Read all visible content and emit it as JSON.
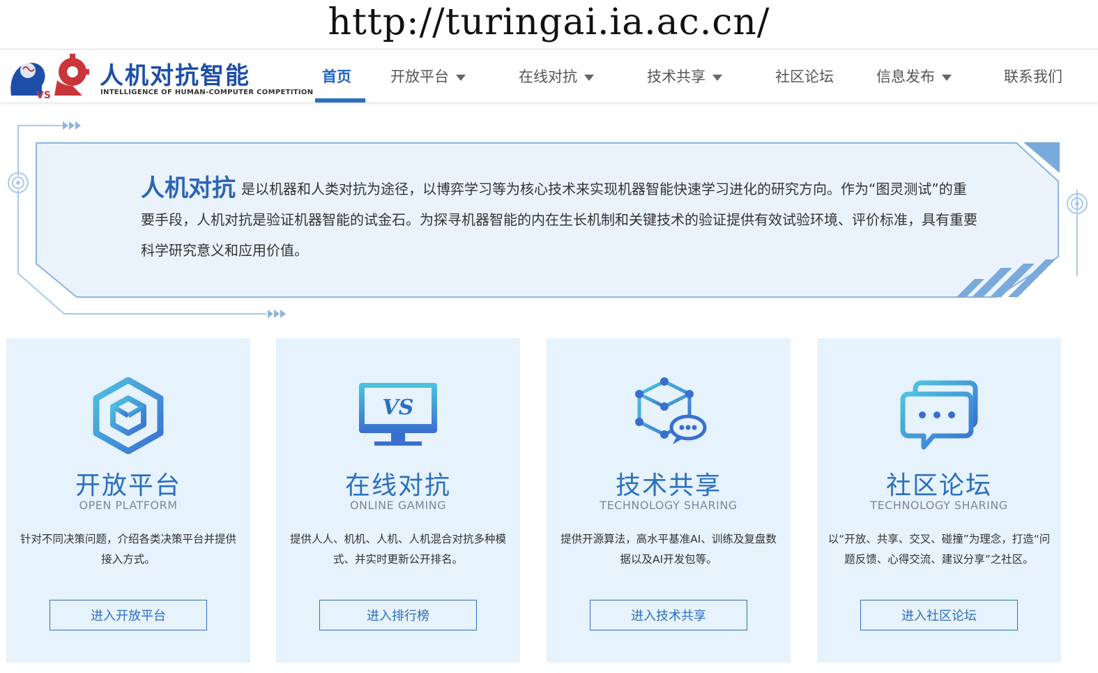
{
  "caption": {
    "url": "http://turingai.ia.ac.cn/"
  },
  "header": {
    "logo_title": "人机对抗智能",
    "logo_subtitle": "INTELLIGENCE OF HUMAN-COMPUTER COMPETITION",
    "logo_vs": "VS",
    "nav": [
      {
        "label": "首页",
        "active": true,
        "dropdown": false
      },
      {
        "label": "开放平台",
        "active": false,
        "dropdown": true
      },
      {
        "label": "在线对抗",
        "active": false,
        "dropdown": true
      },
      {
        "label": "技术共享",
        "active": false,
        "dropdown": true
      },
      {
        "label": "社区论坛",
        "active": false,
        "dropdown": false
      },
      {
        "label": "信息发布",
        "active": false,
        "dropdown": true
      },
      {
        "label": "联系我们",
        "active": false,
        "dropdown": false
      }
    ]
  },
  "intro": {
    "lead": "人机对抗",
    "text": "是以机器和人类对抗为途径，以博弈学习等为核心技术来实现机器智能快速学习进化的研究方向。作为“图灵测试”的重要手段，人机对抗是验证机器智能的试金石。为探寻机器智能的内在生长机制和关键技术的验证提供有效试验环境、评价标准，具有重要科学研究意义和应用价值。"
  },
  "cards": [
    {
      "icon": "cube-icon",
      "title": "开放平台",
      "subtitle": "OPEN PLATFORM",
      "desc": "针对不同决策问题，介绍各类决策平台并提供接入方式。",
      "button": "进入开放平台"
    },
    {
      "icon": "vs-monitor-icon",
      "title": "在线对抗",
      "subtitle": "ONLINE GAMING",
      "icon_text": "VS",
      "desc": "提供人人、机机、人机、人机混合对抗多种模式、并实时更新公开排名。",
      "button": "进入排行榜"
    },
    {
      "icon": "network-cube-chat-icon",
      "title": "技术共享",
      "subtitle": "TECHNOLOGY SHARING",
      "desc": "提供开源算法，高水平基准AI、训练及复盘数据以及AI开发包等。",
      "button": "进入技术共享"
    },
    {
      "icon": "chat-bubbles-icon",
      "title": "社区论坛",
      "subtitle": "TECHNOLOGY SHARING",
      "desc": "以“开放、共享、交叉、碰撞”为理念，打造“问题反馈、心得交流、建议分享”之社区。",
      "button": "进入社区论坛"
    }
  ],
  "colors": {
    "brand_blue": "#1d4fa8",
    "accent_blue": "#2c6fbe",
    "card_bg": "#e6f2fc",
    "banner_bg": "#eaf3fc",
    "logo_red": "#c8363a"
  }
}
